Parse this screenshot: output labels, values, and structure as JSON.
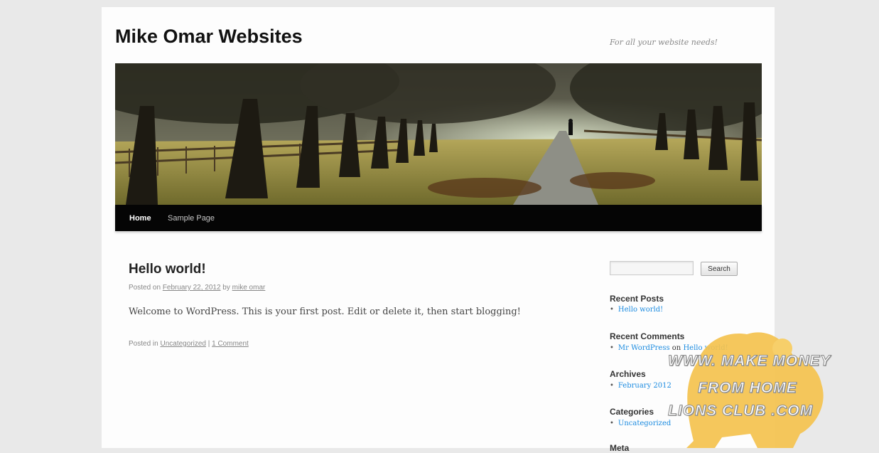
{
  "site": {
    "title": "Mike Omar Websites",
    "tagline": "For all your website needs!"
  },
  "nav": {
    "items": [
      {
        "label": "Home",
        "active": true
      },
      {
        "label": "Sample Page",
        "active": false
      }
    ]
  },
  "post": {
    "title": "Hello world!",
    "meta_prefix": "Posted on ",
    "date": "February 22, 2012",
    "meta_by": " by ",
    "author": "mike omar",
    "body": "Welcome to WordPress. This is your first post. Edit or delete it, then start blogging!",
    "footer_prefix": "Posted in ",
    "category": "Uncategorized",
    "footer_sep": " | ",
    "comments": "1 Comment"
  },
  "sidebar": {
    "search_button": "Search",
    "search_value": "",
    "recent_posts": {
      "title": "Recent Posts",
      "items": [
        "Hello world!"
      ]
    },
    "recent_comments": {
      "title": "Recent Comments",
      "author": "Mr WordPress",
      "on": " on ",
      "post": "Hello world!"
    },
    "archives": {
      "title": "Archives",
      "items": [
        "February 2012"
      ]
    },
    "categories": {
      "title": "Categories",
      "items": [
        "Uncategorized"
      ]
    },
    "meta": {
      "title": "Meta"
    }
  },
  "watermark": {
    "line1": "WWW. MAKE MONEY",
    "line2": "FROM HOME",
    "line3": "LIONS CLUB .COM",
    "color": "#f4c24e"
  },
  "colors": {
    "link": "#1b8be0",
    "nav_bg": "#050505",
    "page_bg": "#fdfdfd",
    "outer_bg": "#e9e9e9"
  }
}
